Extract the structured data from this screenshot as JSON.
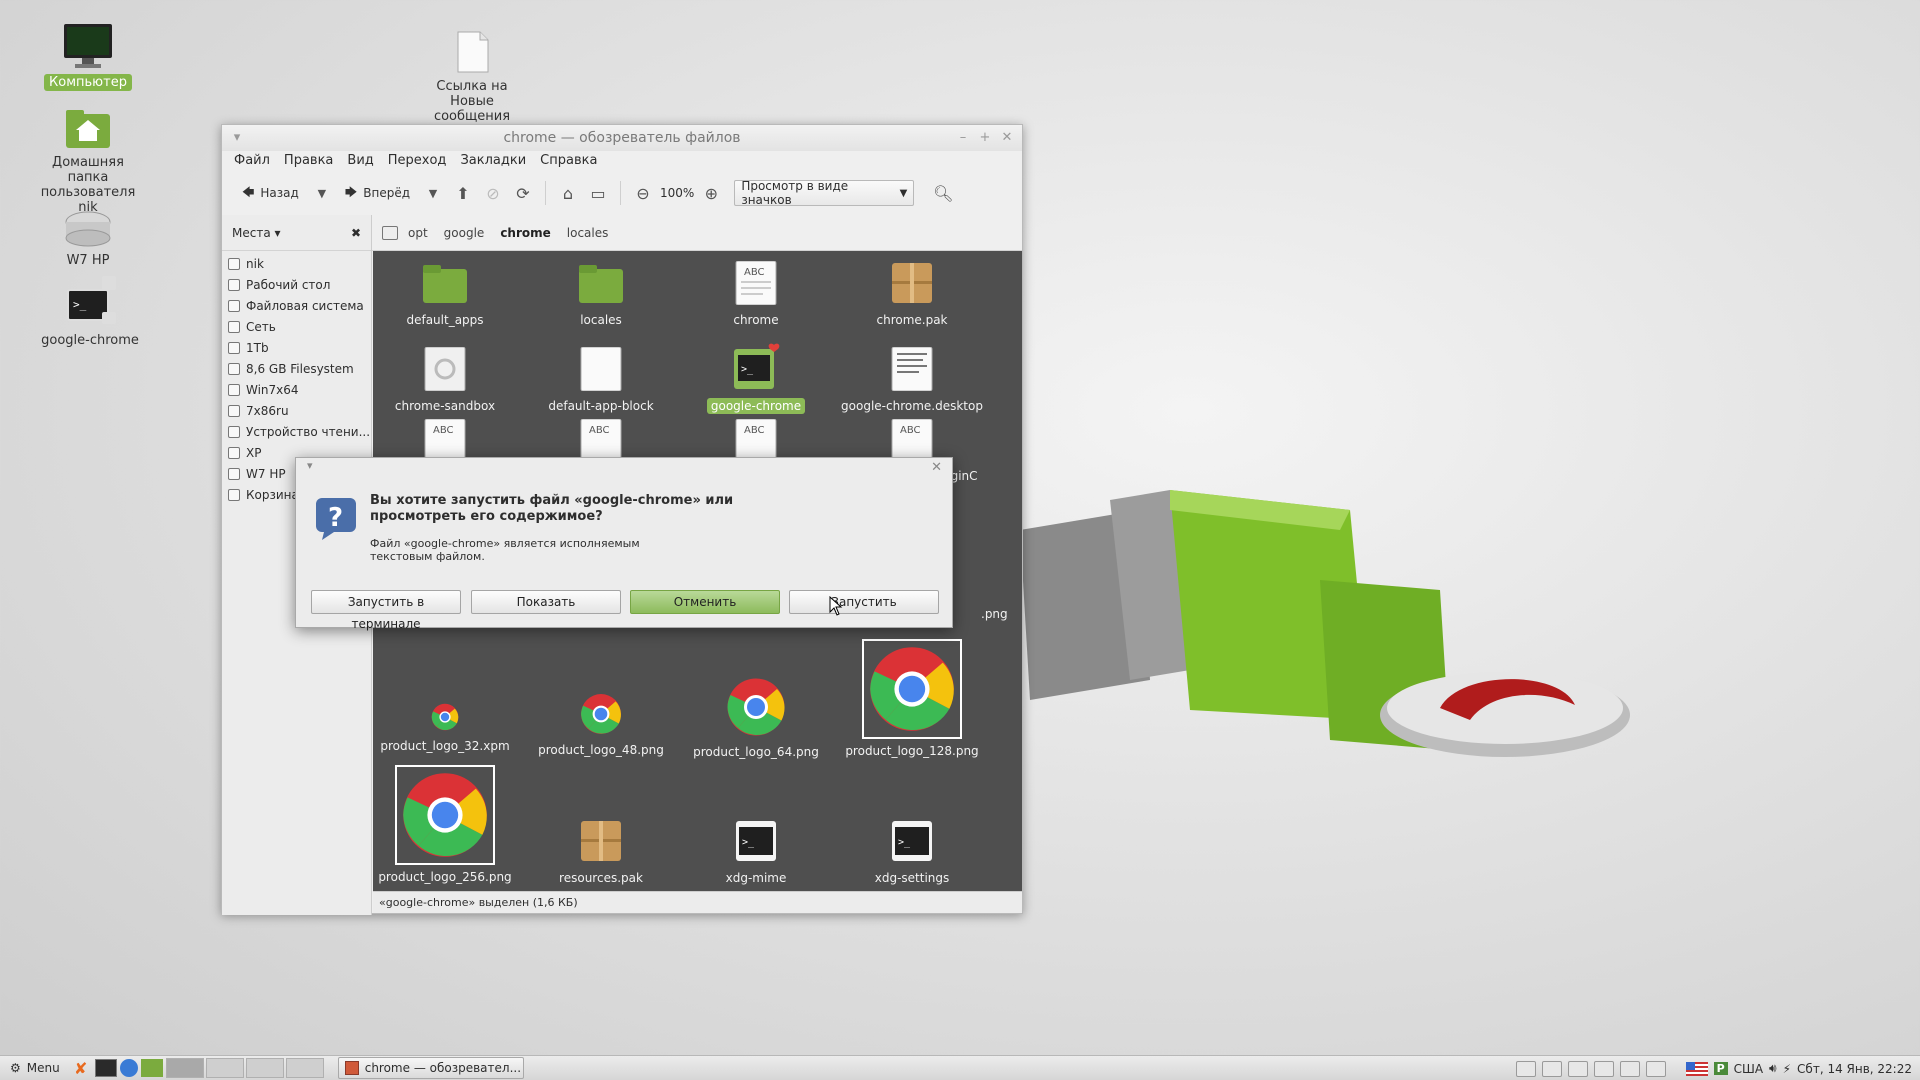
{
  "desktop": {
    "icons": [
      {
        "label": "Компьютер"
      },
      {
        "label": "Домашняя папка пользователя nik"
      },
      {
        "label": "W7 HP"
      },
      {
        "label": "google-chrome"
      },
      {
        "label": "Ссылка на Новые сообщения"
      }
    ]
  },
  "window": {
    "title": "chrome — обозреватель файлов",
    "menu": [
      "Файл",
      "Правка",
      "Вид",
      "Переход",
      "Закладки",
      "Справка"
    ],
    "toolbar": {
      "back": "Назад",
      "forward": "Вперёд",
      "zoom": "100%",
      "view_mode": "Просмотр в виде значков"
    },
    "sidebar": {
      "header": "Места",
      "items": [
        "nik",
        "Рабочий стол",
        "Файловая система",
        "Сеть",
        "1Tb",
        "8,6 GB Filesystem",
        "Win7x64",
        "7x86ru",
        "Устройство чтени...",
        "XP",
        "W7 HP",
        "Корзина"
      ]
    },
    "path": [
      "opt",
      "google",
      "chrome",
      "locales"
    ],
    "files": {
      "f1": "default_apps",
      "f2": "locales",
      "f3": "chrome",
      "f4": "chrome.pak",
      "f5": "chrome-sandbox",
      "f6": "default-app-block",
      "f7": "google-chrome",
      "f8": "google-chrome.desktop",
      "f9": "uginC",
      "f10": ".png",
      "f11": "product_logo_32.xpm",
      "f12": "product_logo_48.png",
      "f13": "product_logo_64.png",
      "f14": "product_logo_128.png",
      "f15": "product_logo_256.png",
      "f16": "resources.pak",
      "f17": "xdg-mime",
      "f18": "xdg-settings"
    },
    "abc": "ABC",
    "status": "«google-chrome» выделен (1,6 КБ)"
  },
  "dialog": {
    "title": "Вы хотите запустить файл «google-chrome» или просмотреть его содержимое?",
    "subtitle": "Файл «google-chrome» является исполняемым текстовым файлом.",
    "buttons": {
      "terminal": "Запустить в терминале",
      "show": "Показать",
      "cancel": "Отменить",
      "run": "Запустить"
    }
  },
  "panel": {
    "menu": "Menu",
    "task": "chrome — обозревател...",
    "keyboard": "США",
    "clock": "Сбт, 14 Янв, 22:22"
  },
  "colors": {
    "accent": "#8dbb57",
    "content_bg": "#4f4f4f"
  }
}
